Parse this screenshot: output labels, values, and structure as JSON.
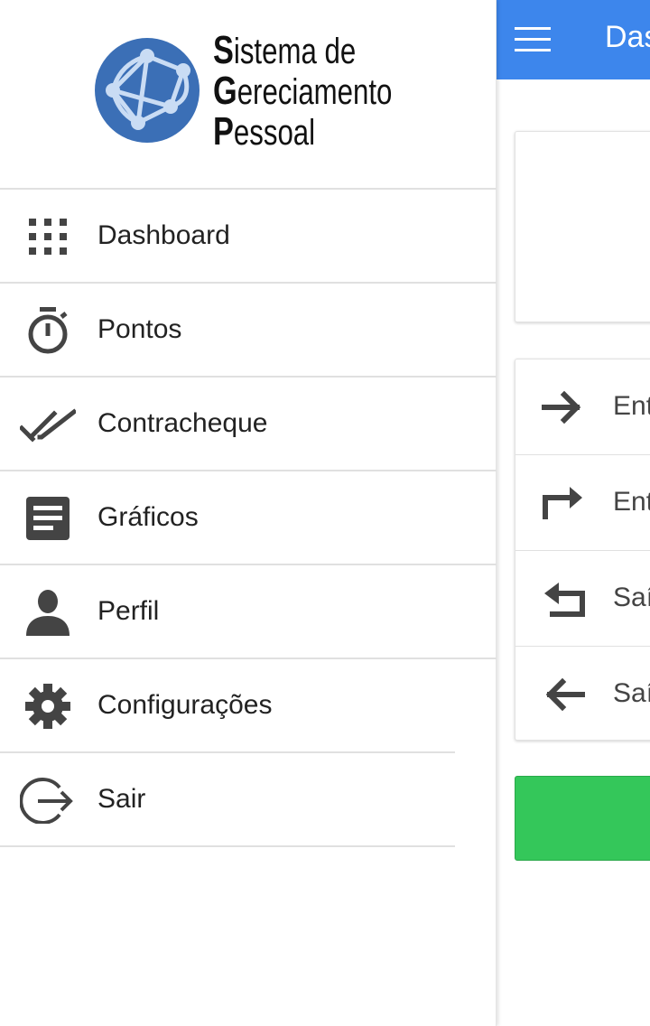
{
  "app": {
    "title_partial": "Das"
  },
  "logo": {
    "lines": [
      {
        "initial": "S",
        "rest": "istema de"
      },
      {
        "initial": "G",
        "rest": "ereciamento"
      },
      {
        "initial": "P",
        "rest": "essoal"
      }
    ],
    "globe_color": "#3b6fb6"
  },
  "drawer": {
    "items": [
      {
        "label": "Dashboard",
        "icon": "grid-icon"
      },
      {
        "label": "Pontos",
        "icon": "stopwatch-icon"
      },
      {
        "label": "Contracheque",
        "icon": "double-check-icon"
      },
      {
        "label": "Gráficos",
        "icon": "document-icon"
      },
      {
        "label": "Perfil",
        "icon": "person-icon"
      },
      {
        "label": "Configurações",
        "icon": "gear-icon"
      },
      {
        "label": "Sair",
        "icon": "exit-icon"
      }
    ]
  },
  "punches": {
    "items": [
      {
        "label": "Ent",
        "icon": "arrow-right-icon"
      },
      {
        "label": "Ent",
        "icon": "redo-arrow-icon"
      },
      {
        "label": "Saí",
        "icon": "undo-arrow-icon"
      },
      {
        "label": "Saí",
        "icon": "arrow-left-icon"
      }
    ]
  },
  "colors": {
    "app_bar": "#3d86ec",
    "green_button": "#34c75a",
    "icon": "#444444"
  }
}
